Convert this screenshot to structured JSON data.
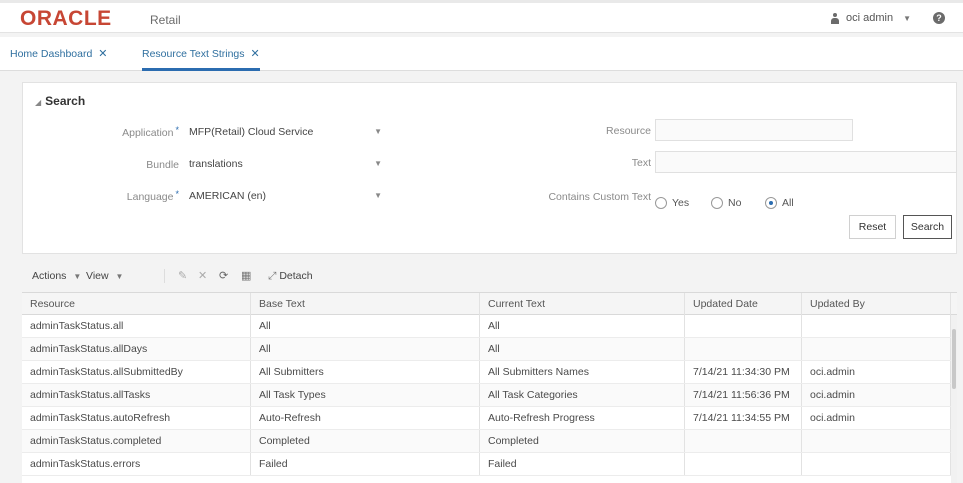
{
  "app": {
    "logo_text": "ORACLE",
    "logo_sub": "Retail",
    "user_label": "oci admin"
  },
  "tabs": [
    {
      "label": "Home Dashboard"
    },
    {
      "label": "Resource Text Strings"
    }
  ],
  "search": {
    "title": "Search",
    "application_label": "Application",
    "application_value": "MFP(Retail) Cloud Service",
    "bundle_label": "Bundle",
    "bundle_value": "translations",
    "language_label": "Language",
    "language_value": "AMERICAN (en)",
    "resource_label": "Resource",
    "resource_value": "",
    "text_label": "Text",
    "text_value": "",
    "custom_label": "Contains Custom Text",
    "options": [
      "Yes",
      "No",
      "All"
    ],
    "selected_option": "All",
    "reset_label": "Reset",
    "search_label": "Search"
  },
  "toolbar": {
    "actions_label": "Actions",
    "view_label": "View",
    "detach_label": "Detach"
  },
  "table": {
    "columns": [
      "Resource",
      "Base Text",
      "Current Text",
      "Updated Date",
      "Updated By"
    ],
    "rows": [
      [
        "adminTaskStatus.all",
        "All",
        "All",
        "",
        ""
      ],
      [
        "adminTaskStatus.allDays",
        "All",
        "All",
        "",
        ""
      ],
      [
        "adminTaskStatus.allSubmittedBy",
        "All Submitters",
        "All Submitters Names",
        "7/14/21 11:34:30 PM",
        "oci.admin"
      ],
      [
        "adminTaskStatus.allTasks",
        "All Task Types",
        "All Task Categories",
        "7/14/21 11:56:36 PM",
        "oci.admin"
      ],
      [
        "adminTaskStatus.autoRefresh",
        "Auto-Refresh",
        "Auto-Refresh Progress",
        "7/14/21 11:34:55 PM",
        "oci.admin"
      ],
      [
        "adminTaskStatus.completed",
        "Completed",
        "Completed",
        "",
        ""
      ],
      [
        "adminTaskStatus.errors",
        "Failed",
        "Failed",
        "",
        ""
      ]
    ]
  },
  "colors": {
    "brand": "#c74634",
    "link": "#2f6f9f",
    "accent": "#2b6cb0"
  }
}
